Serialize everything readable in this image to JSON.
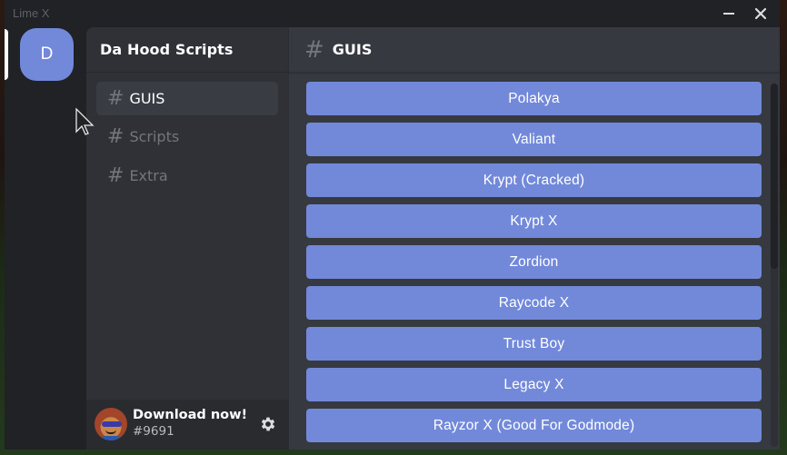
{
  "window": {
    "title": "Lime X",
    "minimize_label": "minimize",
    "close_label": "close"
  },
  "server_rail": {
    "servers": [
      {
        "initial": "D",
        "active": true,
        "color": "#7289da"
      }
    ]
  },
  "channels": {
    "server_name": "Da Hood Scripts",
    "items": [
      {
        "hash": "#",
        "label": "GUIS",
        "active": true
      },
      {
        "hash": "#",
        "label": "Scripts",
        "active": false
      },
      {
        "hash": "#",
        "label": "Extra",
        "active": false
      }
    ]
  },
  "user_panel": {
    "name": "Download now!",
    "tag": "#9691",
    "avatar_icon": "roblox-avatar",
    "settings_icon": "gear-icon"
  },
  "main": {
    "hash": "#",
    "channel_title": "GUIS",
    "buttons": [
      "Polakya",
      "Valiant",
      "Krypt (Cracked)",
      "Krypt X",
      "Zordion",
      "Raycode X",
      "Trust Boy",
      "Legacy X",
      "Rayzor X (Good For Godmode)"
    ],
    "scroll_position_fraction": 0.0,
    "scroll_visible_fraction": 0.51
  },
  "colors": {
    "accent": "#7289da",
    "rail_bg": "#202225",
    "channels_bg": "#2f3136",
    "main_bg": "#36393f",
    "user_panel_bg": "#292b2f",
    "muted_text": "#72767d"
  }
}
